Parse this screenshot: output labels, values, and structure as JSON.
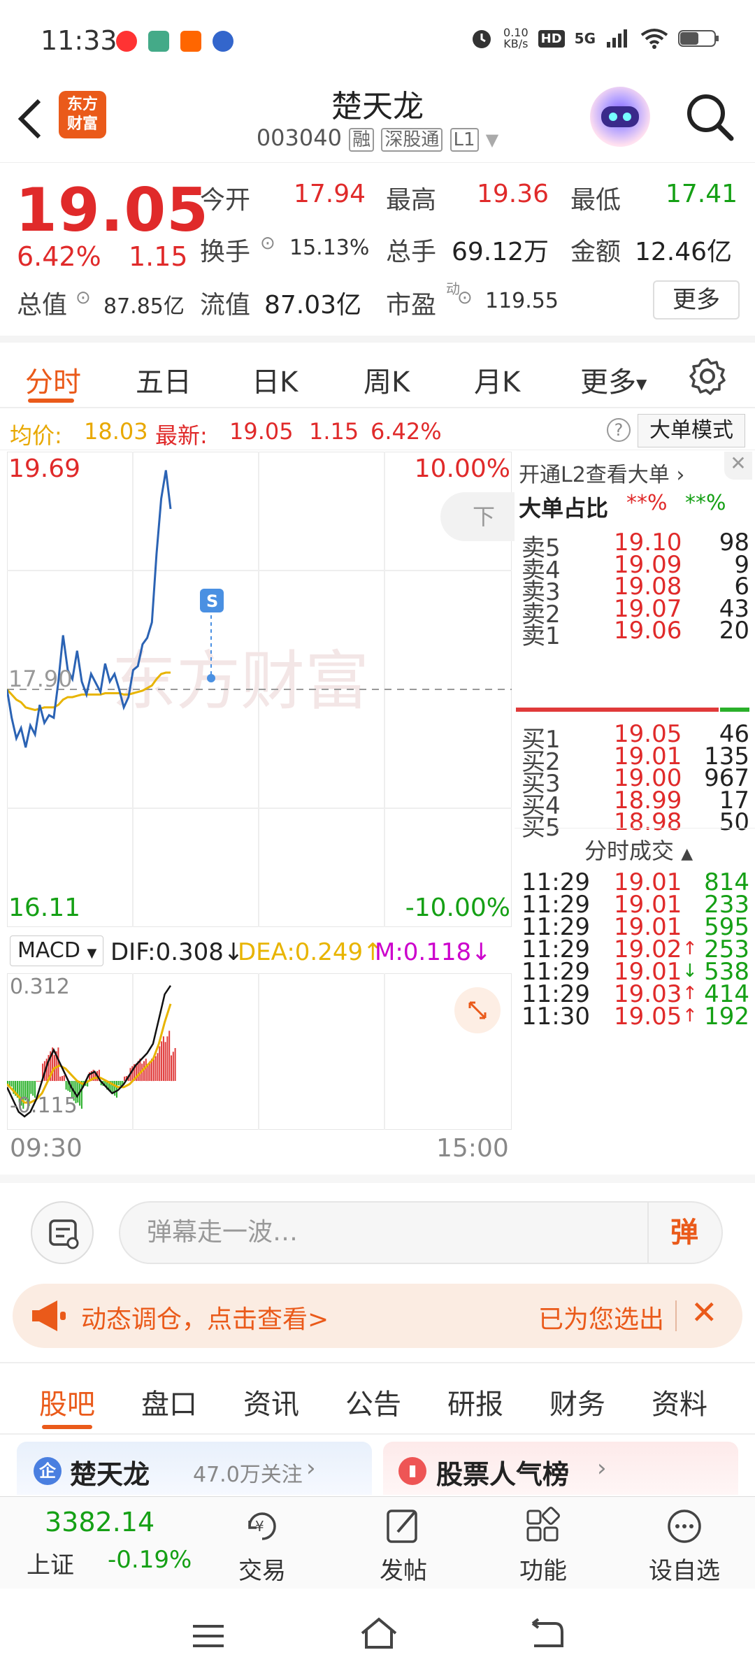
{
  "status_bar": {
    "time": "11:33",
    "net_speed": "0.10\nKB/s",
    "hd": "HD",
    "signal": "5G"
  },
  "header": {
    "title": "楚天龙",
    "code": "003040",
    "tags": [
      "融",
      "深股通",
      "L1"
    ],
    "logo_line1": "东方",
    "logo_line2": "财富"
  },
  "quote": {
    "price": "19.05",
    "change_pct": "6.42%",
    "change_amt": "1.15",
    "open_label": "今开",
    "open": "17.94",
    "high_label": "最高",
    "high": "19.36",
    "low_label": "最低",
    "low": "17.41",
    "turnover_label": "换手",
    "turnover": "15.13%",
    "volume_label": "总手",
    "volume": "69.12万",
    "amount_label": "金额",
    "amount": "12.46亿",
    "mktcap_label": "总值",
    "mktcap": "87.85亿",
    "float_label": "流值",
    "float": "87.03亿",
    "pe_label": "市盈",
    "pe_sup": "动",
    "pe": "119.55",
    "more_label": "更多"
  },
  "kline_tabs": [
    "分时",
    "五日",
    "日K",
    "周K",
    "月K",
    "更多"
  ],
  "avg_bar": {
    "avg_label": "均价:",
    "avg": "18.03",
    "latest_label": "最新:",
    "latest": "19.05",
    "chg": "1.15",
    "pct": "6.42%",
    "mode_label": "大单模式"
  },
  "chart": {
    "top_price": "19.69",
    "bottom_price": "16.11",
    "prev_close": "17.90",
    "top_pct": "10.00%",
    "bottom_pct": "-10.00%",
    "pill": "下午",
    "s_marker": "S",
    "watermark": "东方财富",
    "start_time": "09:30",
    "end_time": "15:00"
  },
  "chart_data": {
    "type": "line",
    "title": "",
    "series": [
      {
        "name": "",
        "color": "#2b63b4",
        "values": [
          17.9,
          17.68,
          17.52,
          17.6,
          17.45,
          17.62,
          17.55,
          17.78,
          17.64,
          17.7,
          17.68,
          17.96,
          18.32,
          18.05,
          17.98,
          18.2,
          17.96,
          17.86,
          18.02,
          17.95,
          17.88,
          18.1,
          17.96,
          18.02,
          17.9,
          17.76,
          17.84,
          18.05,
          18.08,
          18.25,
          18.3,
          18.42,
          18.95,
          19.38,
          19.6,
          19.3
        ]
      },
      {
        "name": "",
        "color": "#e8b400",
        "values": [
          17.9,
          17.86,
          17.82,
          17.8,
          17.76,
          17.75,
          17.74,
          17.75,
          17.76,
          17.76,
          17.76,
          17.78,
          17.82,
          17.84,
          17.84,
          17.85,
          17.86,
          17.86,
          17.86,
          17.86,
          17.86,
          17.87,
          17.87,
          17.87,
          17.87,
          17.86,
          17.86,
          17.87,
          17.88,
          17.89,
          17.91,
          17.93,
          17.98,
          18.02,
          18.03,
          18.03
        ]
      }
    ],
    "ylim": [
      16.11,
      19.69
    ],
    "xlabel": "",
    "ylabel": "",
    "x_ticks": [
      "09:30",
      "15:00"
    ],
    "grid": true
  },
  "macd": {
    "select_label": "MACD",
    "dif": "DIF:0.308",
    "dea": "DEA:0.249",
    "m": "M:0.118",
    "top": "0.312",
    "bottom": "-0.115",
    "dif_values": [
      -0.02,
      -0.06,
      -0.1,
      -0.115,
      -0.1,
      -0.06,
      0.0,
      0.06,
      0.1,
      0.06,
      0.02,
      -0.02,
      -0.05,
      -0.02,
      0.02,
      0.03,
      0.0,
      -0.02,
      -0.04,
      -0.03,
      -0.01,
      0.02,
      0.05,
      0.07,
      0.09,
      0.12,
      0.2,
      0.28,
      0.308
    ],
    "dea_values": [
      -0.01,
      -0.03,
      -0.05,
      -0.07,
      -0.07,
      -0.06,
      -0.04,
      0.0,
      0.04,
      0.05,
      0.04,
      0.02,
      0.0,
      -0.01,
      0.0,
      0.01,
      0.01,
      0.0,
      -0.01,
      -0.02,
      -0.02,
      -0.01,
      0.01,
      0.03,
      0.05,
      0.07,
      0.12,
      0.19,
      0.249
    ]
  },
  "book": {
    "header_link": "开通L2查看大单",
    "ratio_label": "大单占比",
    "ratio_sell": "**%",
    "ratio_buy": "**%",
    "asks": [
      {
        "label": "卖5",
        "price": "19.10",
        "vol": "98"
      },
      {
        "label": "卖4",
        "price": "19.09",
        "vol": "9"
      },
      {
        "label": "卖3",
        "price": "19.08",
        "vol": "6"
      },
      {
        "label": "卖2",
        "price": "19.07",
        "vol": "43"
      },
      {
        "label": "卖1",
        "price": "19.06",
        "vol": "20"
      }
    ],
    "bids": [
      {
        "label": "买1",
        "price": "19.05",
        "vol": "46"
      },
      {
        "label": "买2",
        "price": "19.01",
        "vol": "135"
      },
      {
        "label": "买3",
        "price": "19.00",
        "vol": "967"
      },
      {
        "label": "买4",
        "price": "18.99",
        "vol": "17"
      },
      {
        "label": "买5",
        "price": "18.98",
        "vol": "50"
      }
    ],
    "trades_label": "分时成交",
    "trades": [
      {
        "time": "11:29",
        "price": "19.01",
        "vol": "814",
        "arrow": ""
      },
      {
        "time": "11:29",
        "price": "19.01",
        "vol": "233",
        "arrow": ""
      },
      {
        "time": "11:29",
        "price": "19.01",
        "vol": "595",
        "arrow": ""
      },
      {
        "time": "11:29",
        "price": "19.02",
        "vol": "253",
        "arrow": "↑"
      },
      {
        "time": "11:29",
        "price": "19.01",
        "vol": "538",
        "arrow": "↓"
      },
      {
        "time": "11:29",
        "price": "19.03",
        "vol": "414",
        "arrow": "↑"
      },
      {
        "time": "11:30",
        "price": "19.05",
        "vol": "192",
        "arrow": "↑"
      }
    ]
  },
  "comment": {
    "placeholder": "弹幕走一波…",
    "dan": "弹"
  },
  "banner": {
    "text": "动态调仓，点击查看>",
    "right": "已为您选出"
  },
  "bottom_tabs": [
    "股吧",
    "盘口",
    "资讯",
    "公告",
    "研报",
    "财务",
    "资料"
  ],
  "cards": {
    "left_name": "楚天龙",
    "left_follow": "47.0万关注",
    "right_name": "股票人气榜"
  },
  "nav": {
    "index_value": "3382.14",
    "index_name": "上证",
    "index_pct": "-0.19%",
    "trade": "交易",
    "post": "发帖",
    "func": "功能",
    "watch": "设自选"
  },
  "colors": {
    "accent": "#ea5a1a",
    "up": "#e02a2a",
    "down": "#15a015",
    "price_line": "#2b63b4",
    "avg_line": "#e8b400"
  }
}
